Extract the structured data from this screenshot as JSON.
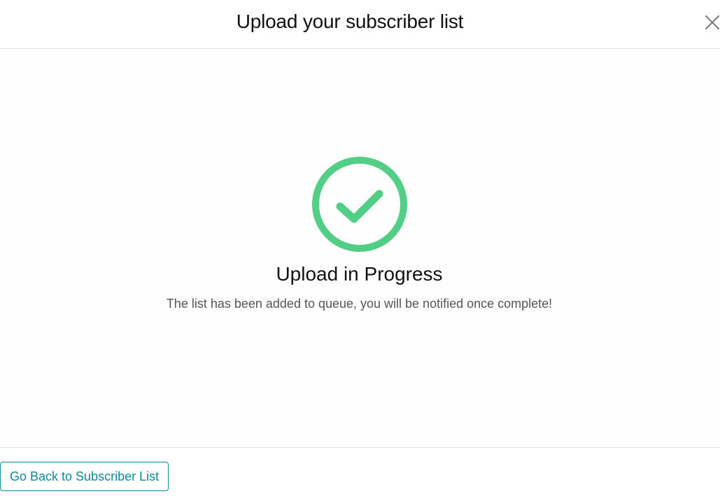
{
  "header": {
    "title": "Upload your subscriber list",
    "close_icon": "close-icon"
  },
  "body": {
    "status_icon": "check-circle-icon",
    "status_title": "Upload in Progress",
    "status_message": "The list has been added to queue, you will be notified once complete!"
  },
  "footer": {
    "back_button_label": "Go Back to Subscriber List"
  },
  "colors": {
    "success": "#52ce87",
    "accent": "#0d8b94"
  }
}
